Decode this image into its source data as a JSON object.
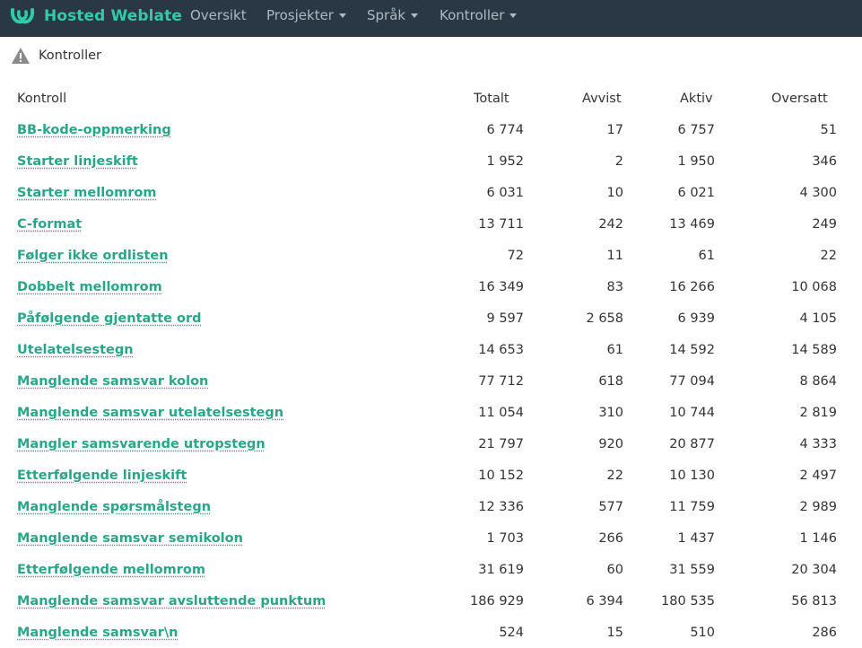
{
  "brand": {
    "name": "Hosted Weblate"
  },
  "nav": [
    {
      "label": "Oversikt",
      "dropdown": false
    },
    {
      "label": "Prosjekter",
      "dropdown": true
    },
    {
      "label": "Språk",
      "dropdown": true
    },
    {
      "label": "Kontroller",
      "dropdown": true
    }
  ],
  "breadcrumb": {
    "label": "Kontroller",
    "icon": "warning-icon"
  },
  "table": {
    "headers": [
      "Kontroll",
      "Totalt",
      "Avvist",
      "Aktiv",
      "Oversatt"
    ],
    "rows": [
      {
        "name": "BB-kode-oppmerking",
        "total": "6 774",
        "dismissed": "17",
        "active": "6 757",
        "translated": "51"
      },
      {
        "name": "Starter linjeskift",
        "total": "1 952",
        "dismissed": "2",
        "active": "1 950",
        "translated": "346"
      },
      {
        "name": "Starter mellomrom",
        "total": "6 031",
        "dismissed": "10",
        "active": "6 021",
        "translated": "4 300"
      },
      {
        "name": "C-format",
        "total": "13 711",
        "dismissed": "242",
        "active": "13 469",
        "translated": "249"
      },
      {
        "name": "Følger ikke ordlisten",
        "total": "72",
        "dismissed": "11",
        "active": "61",
        "translated": "22"
      },
      {
        "name": "Dobbelt mellomrom",
        "total": "16 349",
        "dismissed": "83",
        "active": "16 266",
        "translated": "10 068"
      },
      {
        "name": "Påfølgende gjentatte ord",
        "total": "9 597",
        "dismissed": "2 658",
        "active": "6 939",
        "translated": "4 105"
      },
      {
        "name": "Utelatelsestegn",
        "total": "14 653",
        "dismissed": "61",
        "active": "14 592",
        "translated": "14 589"
      },
      {
        "name": "Manglende samsvar kolon",
        "total": "77 712",
        "dismissed": "618",
        "active": "77 094",
        "translated": "8 864"
      },
      {
        "name": "Manglende samsvar utelatelsestegn",
        "total": "11 054",
        "dismissed": "310",
        "active": "10 744",
        "translated": "2 819"
      },
      {
        "name": "Mangler samsvarende utropstegn",
        "total": "21 797",
        "dismissed": "920",
        "active": "20 877",
        "translated": "4 333"
      },
      {
        "name": "Etterfølgende linjeskift",
        "total": "10 152",
        "dismissed": "22",
        "active": "10 130",
        "translated": "2 497"
      },
      {
        "name": "Manglende spørsmålstegn",
        "total": "12 336",
        "dismissed": "577",
        "active": "11 759",
        "translated": "2 989"
      },
      {
        "name": "Manglende samsvar semikolon",
        "total": "1 703",
        "dismissed": "266",
        "active": "1 437",
        "translated": "1 146"
      },
      {
        "name": "Etterfølgende mellomrom",
        "total": "31 619",
        "dismissed": "60",
        "active": "31 559",
        "translated": "20 304"
      },
      {
        "name": "Manglende samsvar avsluttende punktum",
        "total": "186 929",
        "dismissed": "6 394",
        "active": "180 535",
        "translated": "56 813"
      },
      {
        "name": "Manglende samsvar\\n",
        "total": "524",
        "dismissed": "15",
        "active": "510",
        "translated": "286"
      }
    ]
  },
  "colors": {
    "navbar_bg": "#2a3744",
    "brand": "#2eccaa",
    "link": "#29a68a",
    "nav_text": "#b0b8c0"
  }
}
